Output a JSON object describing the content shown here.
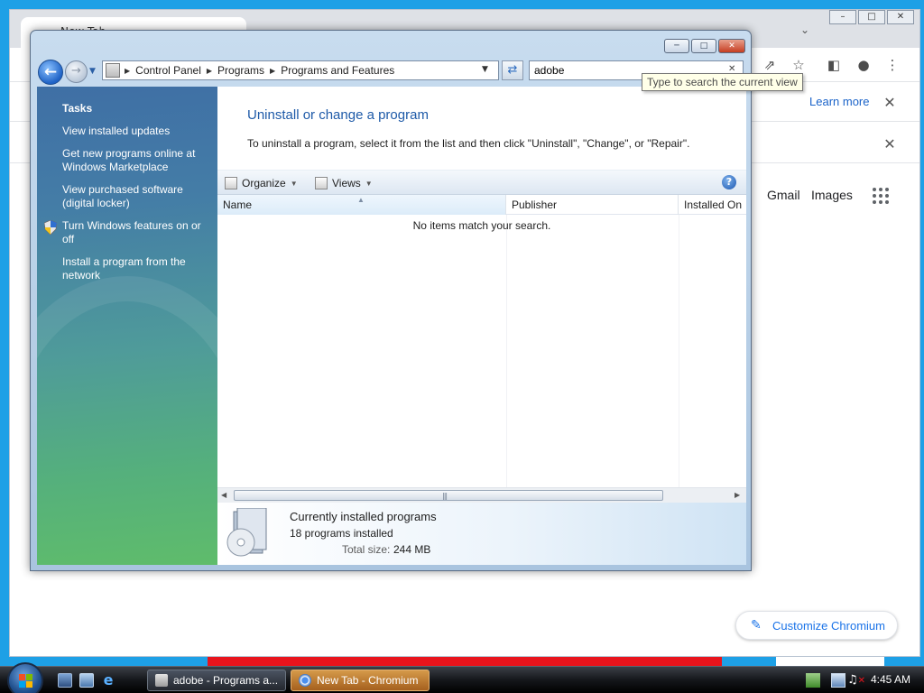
{
  "chromium": {
    "tab_title": "New Tab",
    "learn_more": "Learn more",
    "gmail": "Gmail",
    "images": "Images",
    "customize": "Customize Chromium"
  },
  "window": {
    "breadcrumbs": [
      "Control Panel",
      "Programs",
      "Programs and Features"
    ],
    "search_value": "adobe",
    "tooltip": "Type to search the current view",
    "tasks": {
      "title": "Tasks",
      "links": [
        "View installed updates",
        "Get new programs online at Windows Marketplace",
        "View purchased software (digital locker)",
        "Turn Windows features on or off",
        "Install a program from the network"
      ]
    },
    "main_title": "Uninstall or change a program",
    "main_desc": "To uninstall a program, select it from the list and then click \"Uninstall\", \"Change\", or \"Repair\".",
    "toolbar": {
      "organize": "Organize",
      "views": "Views"
    },
    "columns": [
      "Name",
      "Publisher",
      "Installed On"
    ],
    "empty_message": "No items match your search.",
    "details": {
      "title": "Currently installed programs",
      "count": "18 programs installed",
      "size_label": "Total size:",
      "size_value": "244 MB"
    }
  },
  "taskbar": {
    "buttons": [
      {
        "label": "adobe - Programs a...",
        "active": false
      },
      {
        "label": "New Tab - Chromium",
        "active": true
      }
    ],
    "clock": "4:45 AM"
  },
  "colors": {
    "desktop": "#1ea0e6",
    "link_blue": "#1a63c9",
    "title_blue": "#1e5aa8",
    "taskbar_active": "#c07c32"
  },
  "icons": [
    "back-icon",
    "forward-icon",
    "refresh-icon",
    "shield-icon",
    "help-icon",
    "search-clear-icon",
    "windows-start-icon",
    "show-desktop-icon",
    "internet-explorer-icon",
    "volume-muted-icon",
    "network-icon"
  ]
}
